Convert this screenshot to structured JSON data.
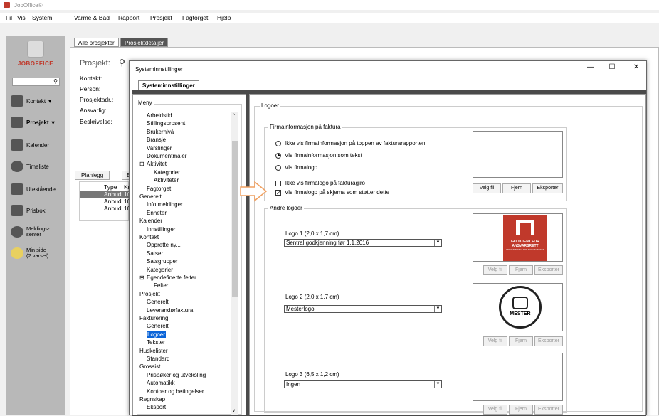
{
  "app": {
    "title": "JobOffice®"
  },
  "menubar": [
    "Fil",
    "Vis",
    "System",
    "Varme & Bad",
    "Rapport",
    "Prosjekt",
    "Fagtorget",
    "Hjelp"
  ],
  "sidebar": {
    "logo_text": "JOBOFFICE",
    "items": [
      {
        "label": "Kontakt",
        "chevron": "▾"
      },
      {
        "label": "Prosjekt",
        "chevron": "▾"
      },
      {
        "label": "Kalender"
      },
      {
        "label": "Timeliste"
      },
      {
        "label": "Utestående"
      },
      {
        "label": "Prisbok"
      },
      {
        "label": "Meldings-\nsenter"
      },
      {
        "label": "Min side\n(2 varsel)"
      }
    ]
  },
  "app_tabs": [
    "Alle prosjekter",
    "Prosjektdetaljer"
  ],
  "project": {
    "label": "Prosjekt:",
    "fields": [
      "Kontakt:",
      "Person:",
      "Prosjektadr.:",
      "Ansvarlig:",
      "Beskrivelse:"
    ],
    "tabs": [
      "Planlegg",
      "Be"
    ],
    "grid_headers": [
      "Type",
      "Kr"
    ],
    "rows": [
      [
        "Anbud",
        "10"
      ],
      [
        "Anbud",
        "10"
      ],
      [
        "Anbud",
        "10"
      ]
    ]
  },
  "dialog": {
    "title": "Systeminnstillinger",
    "tab": "Systeminnstillinger",
    "window_buttons": [
      "—",
      "☐",
      "✕"
    ],
    "menu_legend": "Meny",
    "menu": [
      {
        "label": "Arbeidstid",
        "level": 1
      },
      {
        "label": "Stillingsprosent",
        "level": 1
      },
      {
        "label": "Brukernivå",
        "level": 1
      },
      {
        "label": "Bransje",
        "level": 1
      },
      {
        "label": "Varslinger",
        "level": 1
      },
      {
        "label": "Dokumentmaler",
        "level": 1
      },
      {
        "label": "Aktivitet",
        "level": 1,
        "expander": "⊟"
      },
      {
        "label": "Kategorier",
        "level": 2
      },
      {
        "label": "Aktiviteter",
        "level": 2
      },
      {
        "label": "Fagtorget",
        "level": 1
      },
      {
        "label": "Generelt",
        "level": 0
      },
      {
        "label": "Info.meldinger",
        "level": 1
      },
      {
        "label": "Enheter",
        "level": 1
      },
      {
        "label": "Kalender",
        "level": 0
      },
      {
        "label": "Innstillinger",
        "level": 1
      },
      {
        "label": "Kontakt",
        "level": 0
      },
      {
        "label": "Opprette ny...",
        "level": 1
      },
      {
        "label": "Satser",
        "level": 1
      },
      {
        "label": "Satsgrupper",
        "level": 1
      },
      {
        "label": "Kategorier",
        "level": 1
      },
      {
        "label": "Egendefinerte felter",
        "level": 1,
        "expander": "⊟"
      },
      {
        "label": "Felter",
        "level": 2
      },
      {
        "label": "Prosjekt",
        "level": 0
      },
      {
        "label": "Generelt",
        "level": 1
      },
      {
        "label": "Leverandørfaktura",
        "level": 1
      },
      {
        "label": "Fakturering",
        "level": 0
      },
      {
        "label": "Generelt",
        "level": 1
      },
      {
        "label": "Logoer",
        "level": 1,
        "selected": true
      },
      {
        "label": "Tekster",
        "level": 1
      },
      {
        "label": "Huskelister",
        "level": 0
      },
      {
        "label": "Standard",
        "level": 1
      },
      {
        "label": "Grossist",
        "level": 0
      },
      {
        "label": "Prisbøker og utveksling",
        "level": 1
      },
      {
        "label": "Automatikk",
        "level": 1
      },
      {
        "label": "Kontoer og betingelser",
        "level": 1
      },
      {
        "label": "Regnskap",
        "level": 0
      },
      {
        "label": "Eksport",
        "level": 1
      }
    ],
    "logos_legend": "Logoer",
    "firmainfo": {
      "legend": "Firmainformasjon på faktura",
      "radios": [
        {
          "label": "Ikke vis firmainformasjon på toppen av fakturarapporten",
          "checked": false
        },
        {
          "label": "Vis firmainformasjon som tekst",
          "checked": true
        },
        {
          "label": "Vis firmalogo",
          "checked": false
        }
      ],
      "checks": [
        {
          "label": "Ikke vis firmalogo på fakturagiro",
          "checked": false
        },
        {
          "label": "Vis firmalogo på skjema som støtter dette",
          "checked": true
        }
      ],
      "buttons": [
        "Velg fil",
        "Fjern",
        "Eksporter"
      ]
    },
    "other_logos": {
      "legend": "Andre logoer",
      "logos": [
        {
          "label": "Logo 1 (2,0 x 1,7 cm)",
          "value": "Sentral godkjenning før 1.1.2016",
          "image_text": [
            "GODKJENT FOR",
            "ANSVARSRETT",
            "DIREKTORATET FOR BYGGKVALITET"
          ],
          "image_color": "#c0392b"
        },
        {
          "label": "Logo 2 (2,0 x 1,7 cm)",
          "value": "Mesterlogo",
          "image_text": [
            "MESTER"
          ]
        },
        {
          "label": "Logo 3 (6,5 x 1,2 cm)",
          "value": "Ingen"
        }
      ],
      "buttons": [
        "Velg fil",
        "Fjern",
        "Eksporter"
      ]
    }
  },
  "colors": {
    "selection": "#0a64d8",
    "arrow": "#f0a060",
    "logo_red": "#c0392b"
  }
}
